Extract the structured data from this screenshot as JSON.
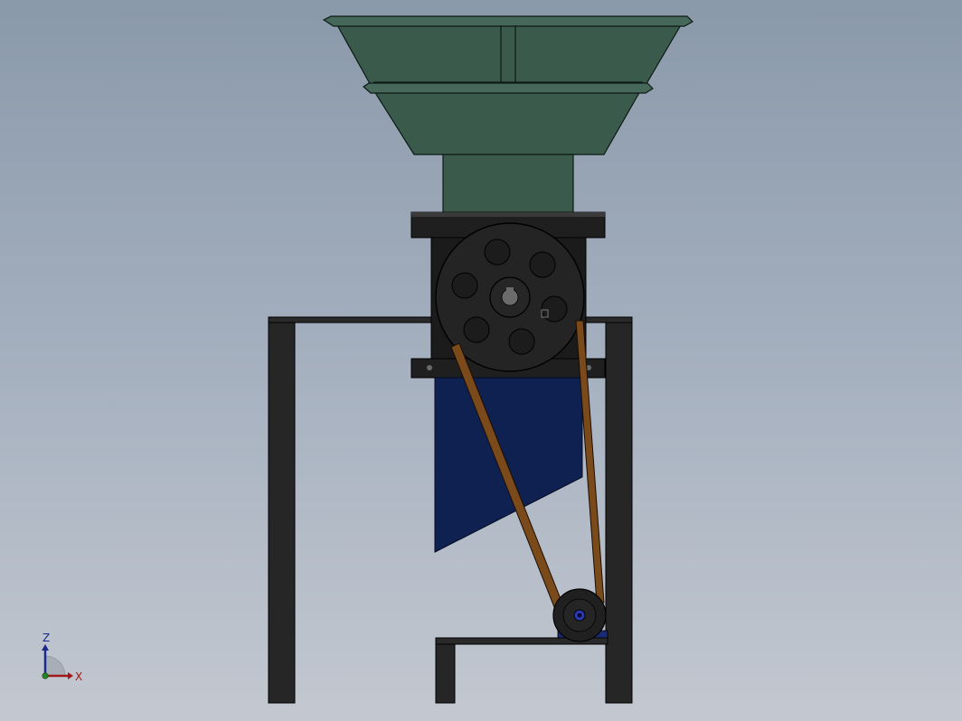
{
  "scene": {
    "view": "front",
    "model": "hopper-crusher-assembly",
    "colors": {
      "background_top": "#8a99aa",
      "background_bottom": "#c3c8d0",
      "hopper": "#3a5a4c",
      "frame": "#262626",
      "housing": "#1e1e1e",
      "pulley": "#242424",
      "belt": "#7a4a1a",
      "chute": "#0f2150"
    }
  },
  "triad": {
    "z_label": "Z",
    "x_label": "X",
    "z_color": "#1a2a8a",
    "x_color": "#a01818"
  }
}
